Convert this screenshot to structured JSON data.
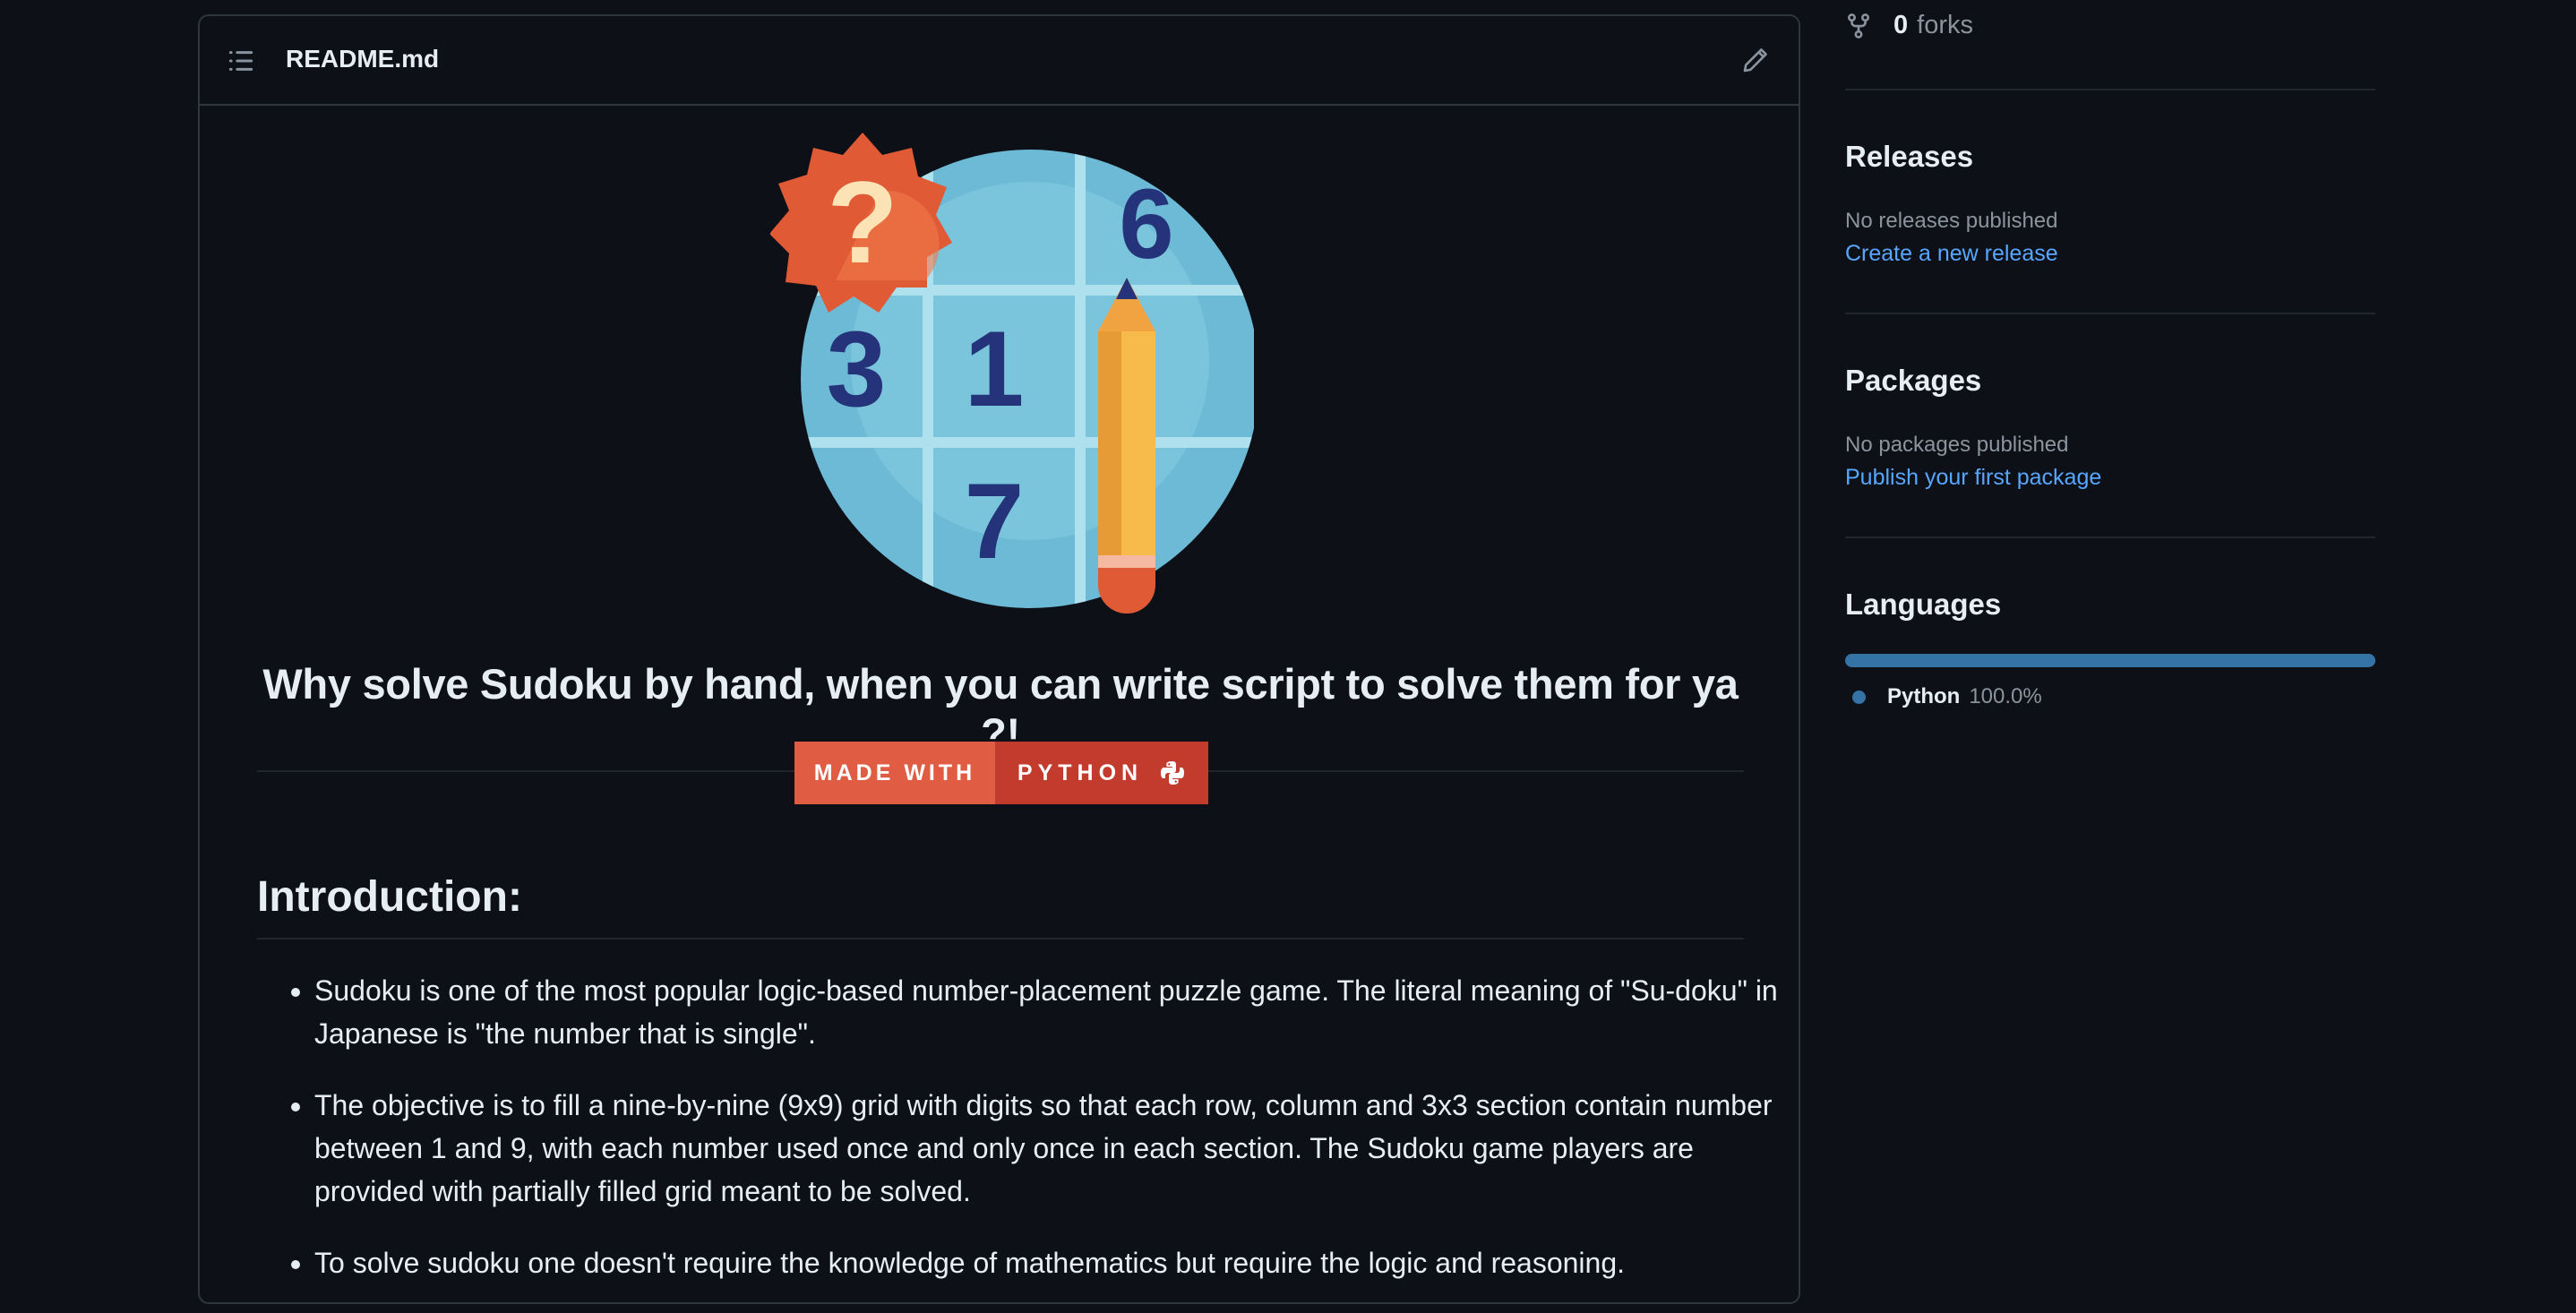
{
  "readme": {
    "filename": "README.md",
    "tagline": "Why solve Sudoku by hand, when you can write script to solve them for ya ?!",
    "badge": {
      "left": "MADE WITH",
      "right": "PYTHON"
    },
    "intro_heading": "Introduction:",
    "intro_items": [
      "Sudoku is one of the most popular logic-based number-placement puzzle game. The literal meaning of \"Su-doku\" in Japanese is \"the number that is single\".",
      "The objective is to fill a nine-by-nine (9x9) grid with digits so that each row, column and 3x3 section contain number between 1 and 9, with each number used once and only once in each section. The Sudoku game players are provided with partially filled grid meant to be solved.",
      "To solve sudoku one doesn't require the knowledge of mathematics but require the logic and reasoning."
    ],
    "hero_digits": [
      "6",
      "3",
      "1",
      "7",
      "?"
    ]
  },
  "sidebar": {
    "forks_count": "0",
    "forks_label": "forks",
    "releases": {
      "heading": "Releases",
      "status": "No releases published",
      "link": "Create a new release"
    },
    "packages": {
      "heading": "Packages",
      "status": "No packages published",
      "link": "Publish your first package"
    },
    "languages": {
      "heading": "Languages",
      "items": [
        {
          "name": "Python",
          "percent": "100.0%",
          "color": "#3572a5"
        }
      ]
    }
  },
  "colors": {
    "background": "#0d1117",
    "border": "#30363d",
    "text": "#e6edf3",
    "muted": "#8b949e",
    "link": "#58a6ff",
    "badge_left": "#e05d44",
    "badge_right": "#c23b2c"
  },
  "icons": [
    "list-icon",
    "pencil-icon",
    "repo-forked-icon",
    "python-logo-icon"
  ]
}
